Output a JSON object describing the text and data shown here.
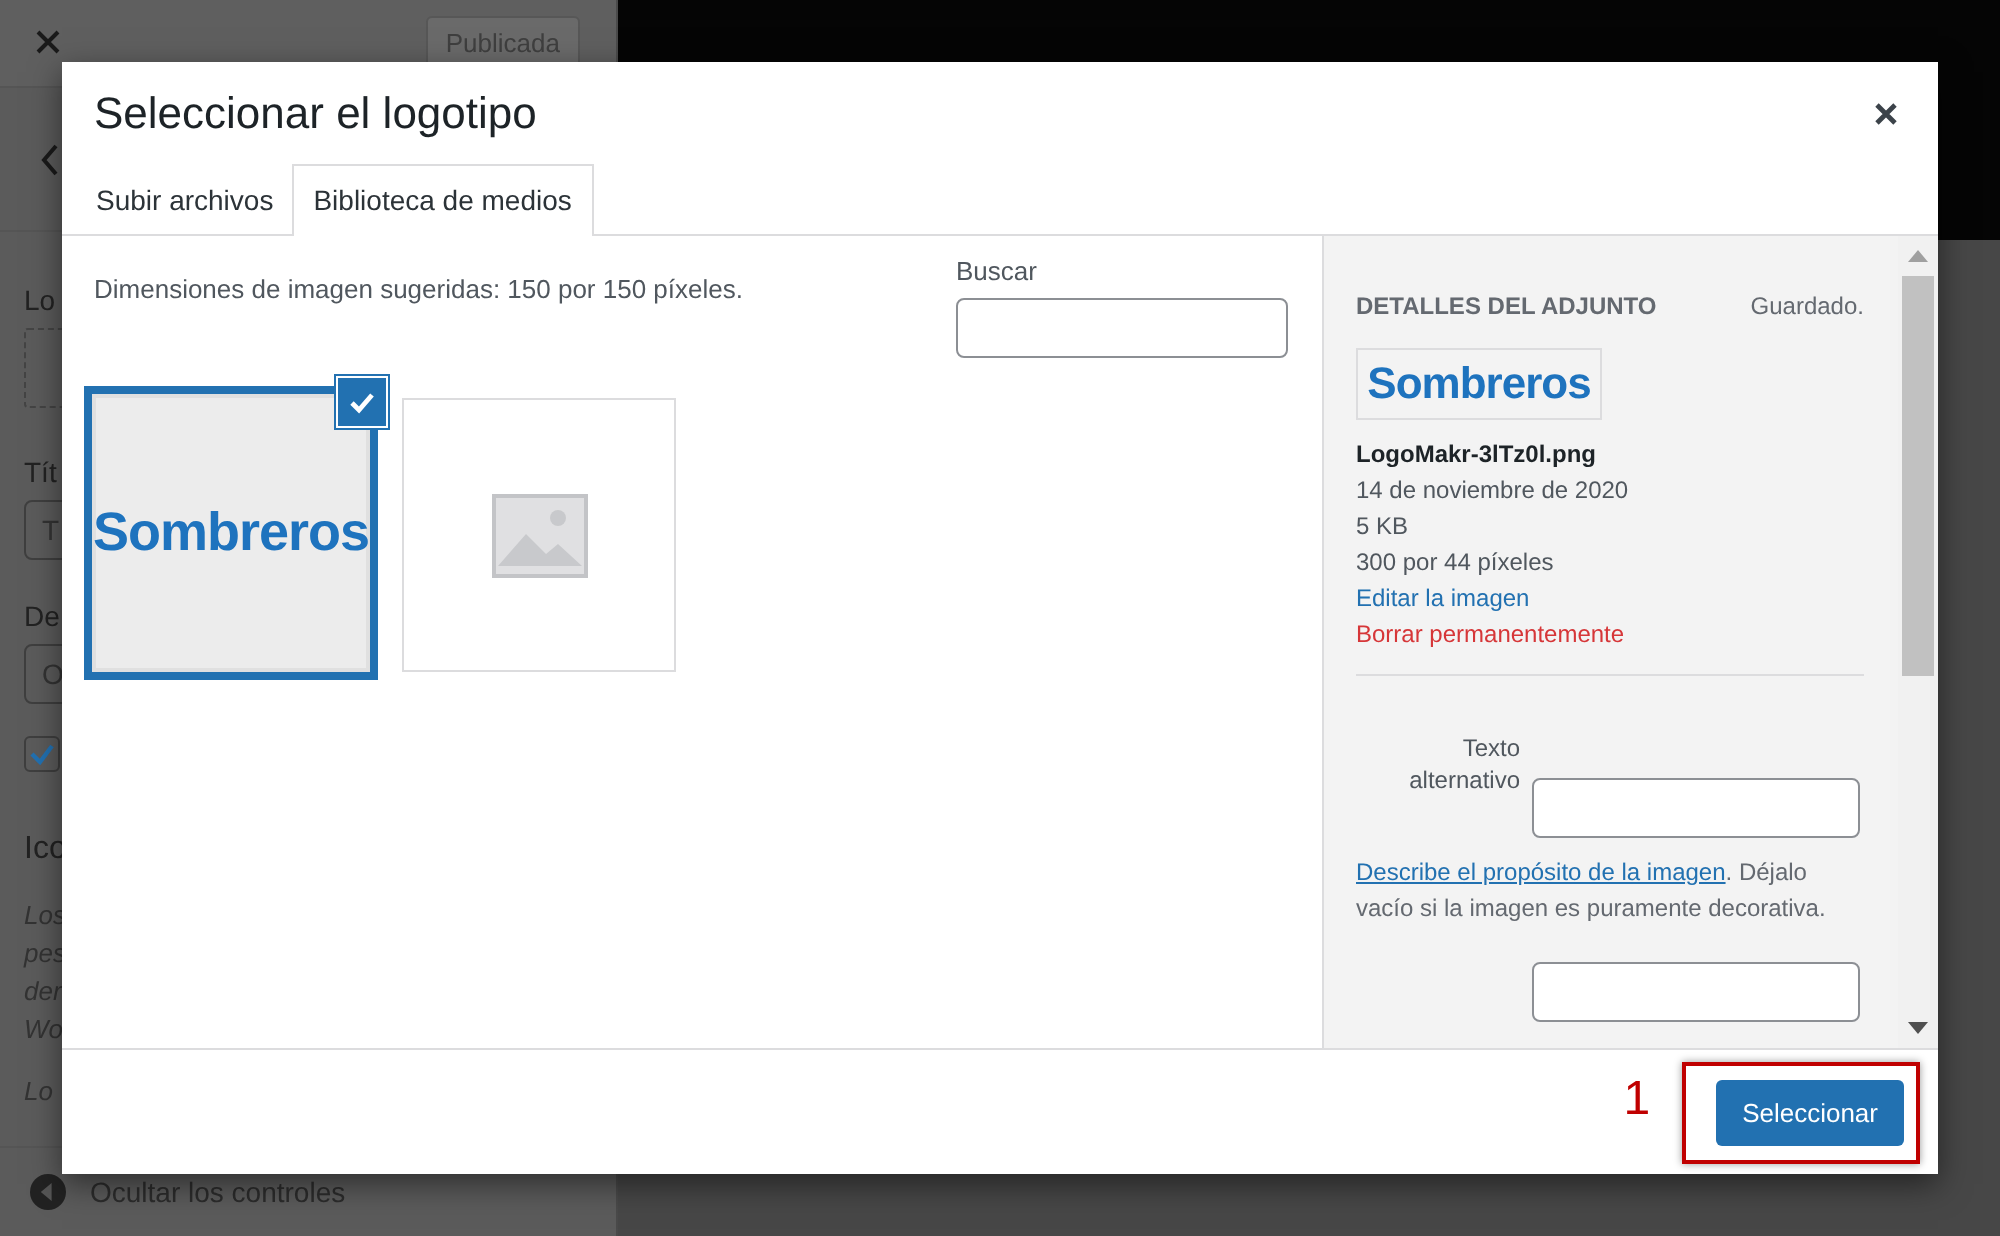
{
  "background": {
    "status_button": "Publicada",
    "fragments": [
      {
        "kind": "label",
        "text": "Lo"
      },
      {
        "kind": "dashed"
      },
      {
        "kind": "label",
        "text": "Tít"
      },
      {
        "kind": "input",
        "text": "T"
      },
      {
        "kind": "label",
        "text": "De"
      },
      {
        "kind": "input",
        "text": "O"
      },
      {
        "kind": "checkbox",
        "checked": true
      },
      {
        "kind": "heading",
        "text": "Ico"
      },
      {
        "kind": "italic",
        "text": "Los"
      },
      {
        "kind": "italic",
        "text": "pes"
      },
      {
        "kind": "italic",
        "text": "der"
      },
      {
        "kind": "italic",
        "text": "Wo"
      },
      {
        "kind": "italic",
        "text": "Lo"
      }
    ],
    "collapse_label": "Ocultar los controles"
  },
  "modal": {
    "title": "Seleccionar el logotipo",
    "tabs": [
      {
        "label": "Subir archivos",
        "selected": false
      },
      {
        "label": "Biblioteca de medios",
        "selected": true
      }
    ],
    "hint": "Dimensiones de imagen sugeridas: 150 por 150 píxeles.",
    "search": {
      "label": "Buscar"
    },
    "attachments": [
      {
        "kind": "logo",
        "text": "Sombreros",
        "selected": true
      },
      {
        "kind": "placeholder",
        "selected": false
      }
    ],
    "details": {
      "heading": "DETALLES DEL ADJUNTO",
      "status": "Guardado.",
      "preview_text": "Sombreros",
      "filename": "LogoMakr-3lTz0l.png",
      "date": "14 de noviembre de 2020",
      "size": "5 KB",
      "dimensions": "300 por 44 píxeles",
      "edit_link": "Editar la imagen",
      "delete_link": "Borrar permanentemente",
      "alt_label": "Texto alternativo",
      "help_link": "Describe el propósito de la imagen",
      "help_text": ". Déjalo vacío si la imagen es puramente decorativa."
    },
    "footer": {
      "button": "Seleccionar"
    },
    "annotation": {
      "label": "1"
    }
  }
}
